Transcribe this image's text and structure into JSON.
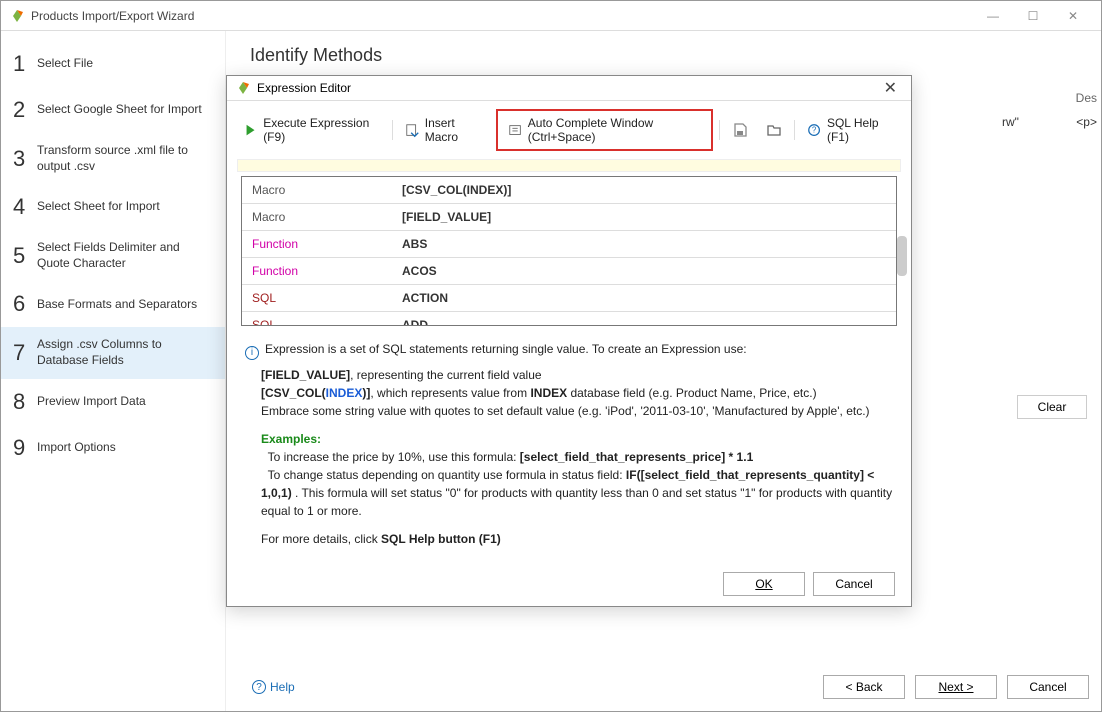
{
  "window": {
    "title": "Products Import/Export Wizard"
  },
  "sidebar": {
    "steps": [
      {
        "num": "1",
        "label": "Select File"
      },
      {
        "num": "2",
        "label": "Select Google Sheet for Import"
      },
      {
        "num": "3",
        "label": "Transform source .xml file to output .csv"
      },
      {
        "num": "4",
        "label": "Select Sheet for Import"
      },
      {
        "num": "5",
        "label": "Select Fields Delimiter and Quote Character"
      },
      {
        "num": "6",
        "label": "Base Formats and Separators"
      },
      {
        "num": "7",
        "label": "Assign .csv Columns to Database Fields"
      },
      {
        "num": "8",
        "label": "Preview Import Data"
      },
      {
        "num": "9",
        "label": "Import Options"
      }
    ],
    "active_index": 6
  },
  "heading": "Identify Methods",
  "background_fragment": {
    "header": "Des",
    "cell1": "rw\"",
    "cell2": "<p>"
  },
  "clear_button": "Clear",
  "footer": {
    "help": "Help",
    "back": "< Back",
    "next": "Next >",
    "cancel": "Cancel"
  },
  "editor": {
    "title": "Expression Editor",
    "toolbar": {
      "execute": "Execute Expression (F9)",
      "insert_macro": "Insert Macro",
      "autocomplete": "Auto Complete Window (Ctrl+Space)",
      "sql_help": "SQL Help (F1)"
    },
    "autocomplete_rows": [
      {
        "kind": "Macro",
        "kind_class": "macro",
        "value": "[CSV_COL(INDEX)]"
      },
      {
        "kind": "Macro",
        "kind_class": "macro",
        "value": "[FIELD_VALUE]"
      },
      {
        "kind": "Function",
        "kind_class": "func",
        "value": "ABS"
      },
      {
        "kind": "Function",
        "kind_class": "func",
        "value": "ACOS"
      },
      {
        "kind": "SQL",
        "kind_class": "sql",
        "value": "ACTION"
      },
      {
        "kind": "SQL",
        "kind_class": "sql",
        "value": "ADD"
      }
    ],
    "info": {
      "intro": "Expression is a set of SQL statements returning single value. To create an Expression use:",
      "field_value_bold": "[FIELD_VALUE]",
      "field_value_rest": ", representing the current field value",
      "csvcol_open": "[CSV_COL(",
      "csvcol_index": "INDEX",
      "csvcol_close": ")]",
      "csvcol_rest": ", which represents value from ",
      "index_word": "INDEX",
      "csvcol_rest2": " database field (e.g. Product Name, Price, etc.)",
      "embrace": "Embrace some string value with quotes to set default value (e.g. 'iPod', '2011-03-10', 'Manufactured by Apple', etc.)",
      "examples_label": "Examples:",
      "ex1_pre": "To increase the price by 10%, use this formula: ",
      "ex1_bold": "[select_field_that_represents_price] * 1.1",
      "ex2_pre": "To change status depending on quantity use formula in status field: ",
      "ex2_bold": "IF([select_field_that_represents_quantity] < 1,0,1)",
      "ex2_post": " . This formula will set status \"0\" for products with quantity less than 0 and set status \"1\" for products with quantity equal to 1 or more.",
      "more_pre": "For more details, click ",
      "more_bold": "SQL Help button (F1)"
    },
    "buttons": {
      "ok": "OK",
      "cancel": "Cancel"
    }
  }
}
